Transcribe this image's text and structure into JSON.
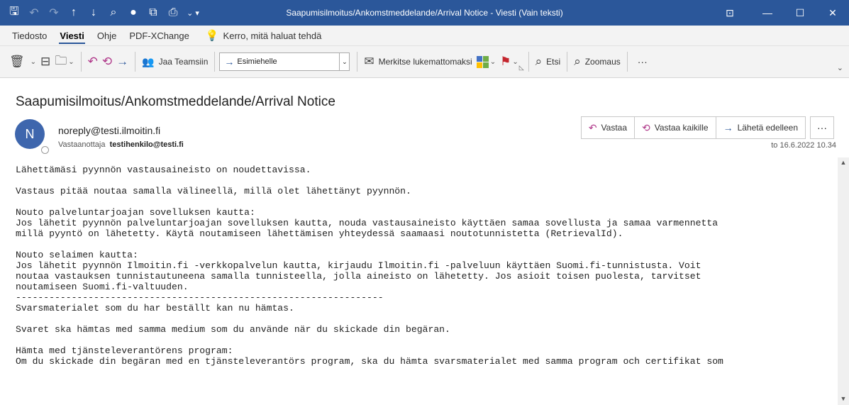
{
  "window": {
    "title": "Saapumisilmoitus/Ankomstmeddelande/Arrival Notice  -  Viesti (Vain teksti)"
  },
  "quick_access": [
    {
      "name": "save-icon",
      "glyph": "🖫",
      "dim": false
    },
    {
      "name": "undo-icon",
      "glyph": "↶",
      "dim": true
    },
    {
      "name": "redo-icon",
      "glyph": "↷",
      "dim": true
    },
    {
      "name": "up-arrow-icon",
      "glyph": "↑",
      "dim": false
    },
    {
      "name": "down-arrow-icon",
      "glyph": "↓",
      "dim": false
    },
    {
      "name": "search-icon",
      "glyph": "⌕",
      "dim": false
    },
    {
      "name": "record-icon",
      "glyph": "●",
      "dim": false
    },
    {
      "name": "copy-icon",
      "glyph": "⧉",
      "dim": false
    },
    {
      "name": "print-icon",
      "glyph": "⎙",
      "dim": false
    }
  ],
  "menu": {
    "tabs": [
      "Tiedosto",
      "Viesti",
      "Ohje",
      "PDF-XChange"
    ],
    "active": 1,
    "tell_me": "Kerro, mitä haluat tehdä"
  },
  "toolbar": {
    "share_teams": "Jaa Teamsiin",
    "quick_step": "Esimiehelle",
    "mark_unread": "Merkitse lukemattomaksi",
    "find": "Etsi",
    "zoom": "Zoomaus",
    "more": "···"
  },
  "message": {
    "subject": "Saapumisilmoitus/Ankomstmeddelande/Arrival Notice",
    "avatar_initial": "N",
    "sender": "noreply@testi.ilmoitin.fi",
    "recipients_label": "Vastaanottaja",
    "recipient": "testihenkilo@testi.fi",
    "date": "to 16.6.2022 10.34",
    "reply": "Vastaa",
    "reply_all": "Vastaa kaikille",
    "forward": "Lähetä edelleen",
    "more": "···",
    "body_lines": [
      "Lähettämäsi pyynnön vastausaineisto on noudettavissa.",
      "",
      "Vastaus pitää noutaa samalla välineellä, millä olet lähettänyt pyynnön.",
      "",
      "Nouto palveluntarjoajan sovelluksen kautta:",
      "Jos lähetit pyynnön palveluntarjoajan sovelluksen kautta, nouda vastausaineisto käyttäen samaa sovellusta ja samaa varmennetta",
      "millä pyyntö on lähetetty. Käytä noutamiseen lähettämisen yhteydessä saamaasi noutotunnistetta (RetrievalId).",
      "",
      "Nouto selaimen kautta:",
      "Jos lähetit pyynnön Ilmoitin.fi -verkkopalvelun kautta, kirjaudu Ilmoitin.fi -palveluun käyttäen Suomi.fi-tunnistusta. Voit",
      "noutaa vastauksen tunnistautuneena samalla tunnisteella, jolla aineisto on lähetetty. Jos asioit toisen puolesta, tarvitset",
      "noutamiseen Suomi.fi-valtuuden.",
      "------------------------------------------------------------------",
      "Svarsmaterialet som du har beställt kan nu hämtas.",
      "",
      "Svaret ska hämtas med samma medium som du använde när du skickade din begäran.",
      "",
      "Hämta med tjänsteleverantörens program:",
      "Om du skickade din begäran med en tjänsteleverantörs program, ska du hämta svarsmaterialet med samma program och certifikat som"
    ]
  },
  "colors": {
    "titlebar": "#2b579a",
    "avatar": "#3e66ad",
    "reply_accent": "#b0388a",
    "flag": "#c4262e"
  }
}
